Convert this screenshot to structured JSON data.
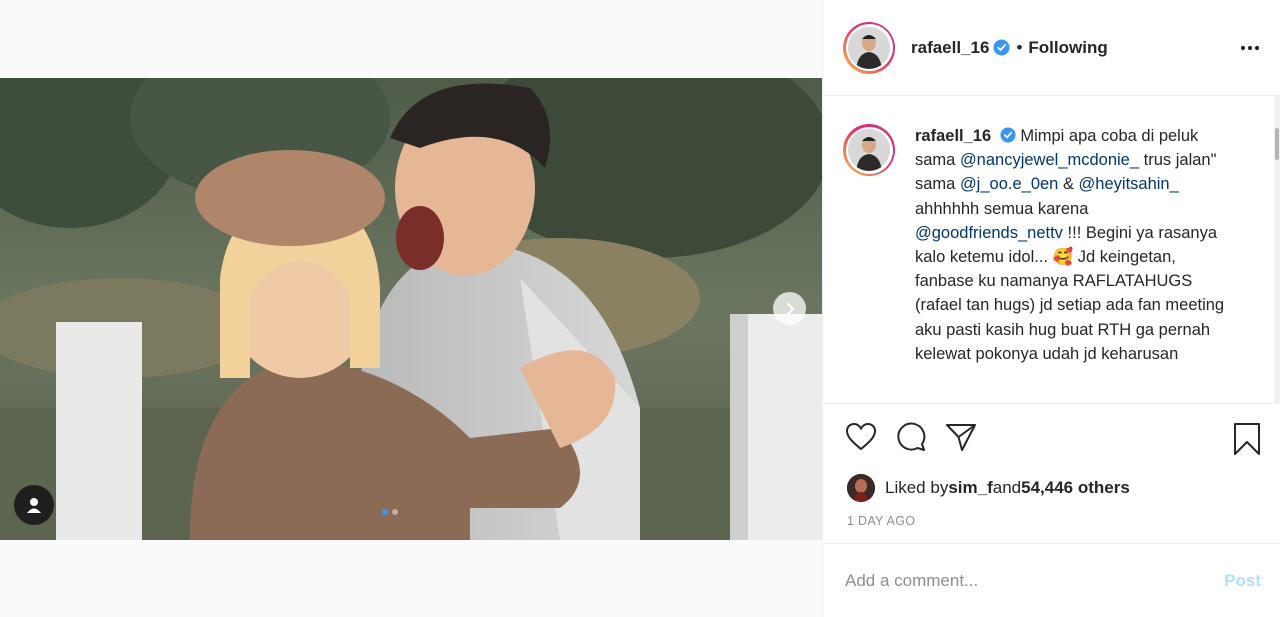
{
  "post": {
    "username": "rafaell_16",
    "separator": "•",
    "follow_status": "Following",
    "more_icon": "more-horizontal-icon"
  },
  "caption": {
    "username": "rafaell_16",
    "part1": " Mimpi apa coba di peluk sama ",
    "mention1": "@nancyjewel_mcdonie_",
    "part2": " trus jalan\" sama ",
    "mention2": "@j_oo.e_0en",
    "part3": " & ",
    "mention3": "@heyitsahin_",
    "part4": " ahhhhhh semua karena ",
    "mention4": "@goodfriends_nettv",
    "part5": " !!! Begini ya rasanya kalo ketemu idol... ",
    "emoji": "🥰",
    "part6": " Jd keingetan, fanbase ku namanya RAFLATAHUGS (rafael tan hugs) jd setiap ada fan meeting aku pasti kasih hug buat RTH ga pernah kelewat pokonya udah jd keharusan"
  },
  "likes": {
    "prefix": "Liked by ",
    "user": "sim_f",
    "middle": " and ",
    "count": "54,446 others"
  },
  "timestamp": "1 DAY AGO",
  "comment": {
    "placeholder": "Add a comment...",
    "post_label": "Post"
  },
  "carousel": {
    "slide_count": 2,
    "active_index": 0
  },
  "colors": {
    "mention": "#00376b",
    "verified": "#3897f0",
    "post_disabled": "#b2dffc",
    "muted": "#8e8e8e"
  },
  "icons": [
    "heart-icon",
    "comment-icon",
    "share-icon",
    "bookmark-icon",
    "next-arrow-icon",
    "user-tag-icon",
    "verified-badge-icon"
  ]
}
